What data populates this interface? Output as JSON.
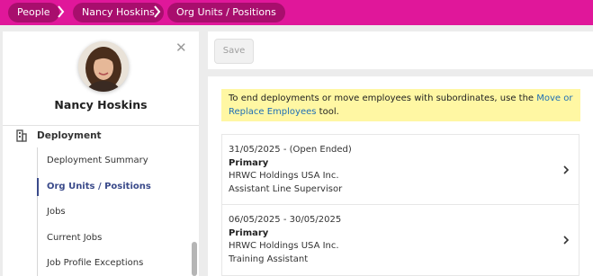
{
  "breadcrumb": {
    "items": [
      "People",
      "Nancy Hoskins",
      "Org Units / Positions"
    ]
  },
  "profile": {
    "name": "Nancy Hoskins",
    "close_label": "✕"
  },
  "nav": {
    "section_label": "Deployment",
    "items": [
      {
        "label": "Deployment Summary",
        "active": false
      },
      {
        "label": "Org Units / Positions",
        "active": true
      },
      {
        "label": "Jobs",
        "active": false
      },
      {
        "label": "Current Jobs",
        "active": false
      },
      {
        "label": "Job Profile Exceptions",
        "active": false
      }
    ]
  },
  "toolbar": {
    "save_label": "Save"
  },
  "notice": {
    "text_before": "To end deployments or move employees with subordinates, use the ",
    "link_text": "Move or Replace Employees",
    "text_after": " tool."
  },
  "deployments": [
    {
      "dates": "31/05/2025 - (Open Ended)",
      "type": "Primary",
      "company": "HRWC Holdings USA Inc.",
      "position": "Assistant Line Supervisor"
    },
    {
      "dates": "06/05/2025 - 30/05/2025",
      "type": "Primary",
      "company": "HRWC Holdings USA Inc.",
      "position": "Training Assistant"
    }
  ],
  "colors": {
    "header_bar": "#e0179a",
    "breadcrumb_pill": "#a80e6d",
    "active_nav": "#3a4a8a",
    "notice_bg": "#fff7a3",
    "link": "#1f6fb5"
  }
}
